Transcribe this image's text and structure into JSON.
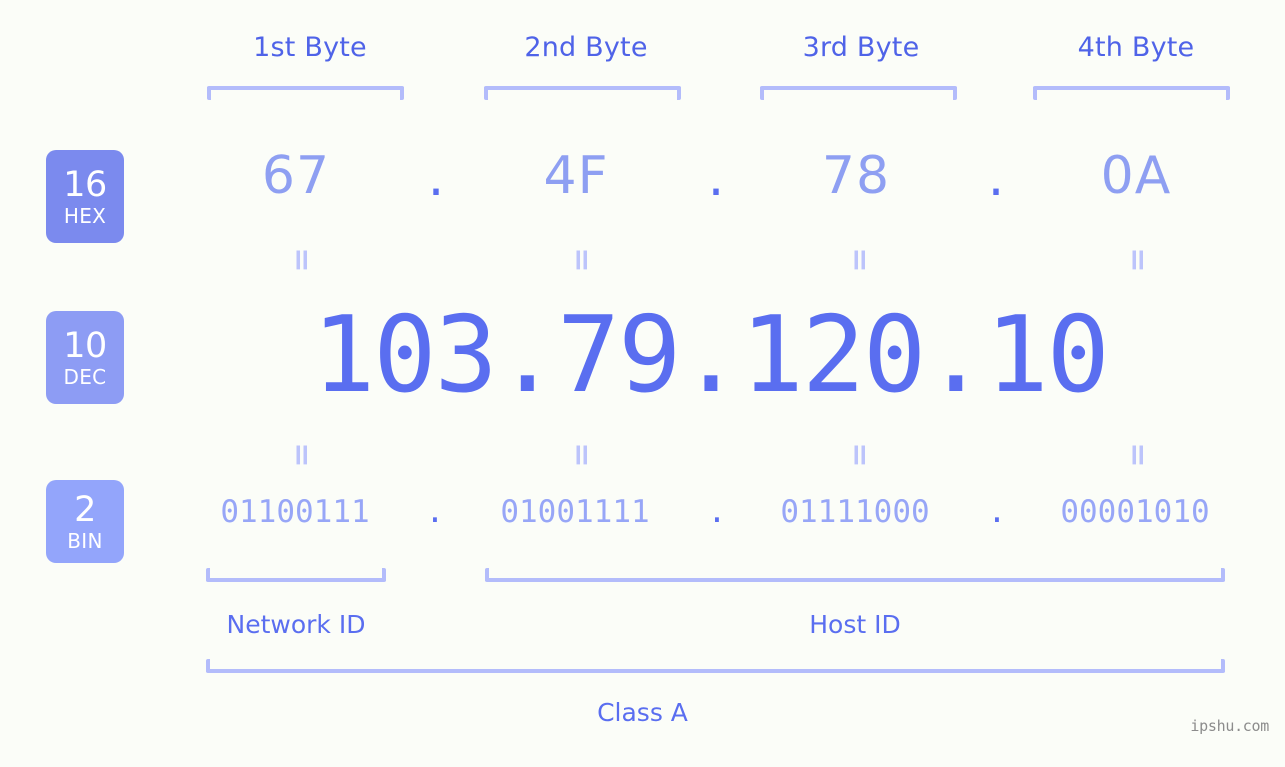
{
  "page": {
    "background_color": "#fbfdf8",
    "accent_color": "#5a6ef0",
    "bracket_color": "#b3bcfb",
    "watermark": "ipshu.com"
  },
  "headers": [
    {
      "label": "1st Byte"
    },
    {
      "label": "2nd Byte"
    },
    {
      "label": "3rd Byte"
    },
    {
      "label": "4th Byte"
    }
  ],
  "bases": [
    {
      "number": "16",
      "name": "HEX",
      "color": "#7b8aee"
    },
    {
      "number": "10",
      "name": "DEC",
      "color": "#8d9cf4"
    },
    {
      "number": "2",
      "name": "BIN",
      "color": "#93a5fb"
    }
  ],
  "rows": {
    "hex": {
      "values": [
        "67",
        "4F",
        "78",
        "0A"
      ],
      "separator": "."
    },
    "dec": {
      "address": "103.79.120.10",
      "values": [
        "103",
        "79",
        "120",
        "10"
      ],
      "separator": "."
    },
    "bin": {
      "values": [
        "01100111",
        "01001111",
        "01111000",
        "00001010"
      ],
      "separator": "."
    }
  },
  "equals_sign": "=",
  "segments": {
    "network_id": "Network ID",
    "host_id": "Host ID",
    "class": "Class A"
  }
}
